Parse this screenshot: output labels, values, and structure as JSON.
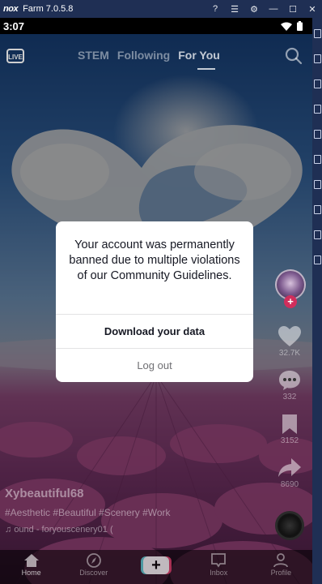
{
  "emulator": {
    "logo": "nox",
    "title": "Farm 7.0.5.8",
    "controls": [
      "help-icon",
      "menu-icon",
      "settings-icon",
      "minimize-icon",
      "maximize-icon",
      "close-icon"
    ]
  },
  "statusbar": {
    "time": "3:07"
  },
  "topnav": {
    "live_label": "LIVE",
    "tabs": [
      {
        "label": "STEM"
      },
      {
        "label": "Following"
      },
      {
        "label": "For You"
      }
    ]
  },
  "actions": {
    "likes": "32.7K",
    "comments": "332",
    "saves": "3152",
    "shares": "8690"
  },
  "caption": {
    "username": "Xybeautiful68",
    "hashtags": "#Aesthetic #Beautiful #Scenery #Work",
    "sound": "ound - foryouscenery01 ("
  },
  "bottomnav": {
    "home": "Home",
    "discover": "Discover",
    "inbox": "Inbox",
    "profile": "Profile"
  },
  "dialog": {
    "message": "Your account was permanently banned due to multiple violations of our Community Guidelines.",
    "download_label": "Download your data",
    "logout_label": "Log out"
  }
}
